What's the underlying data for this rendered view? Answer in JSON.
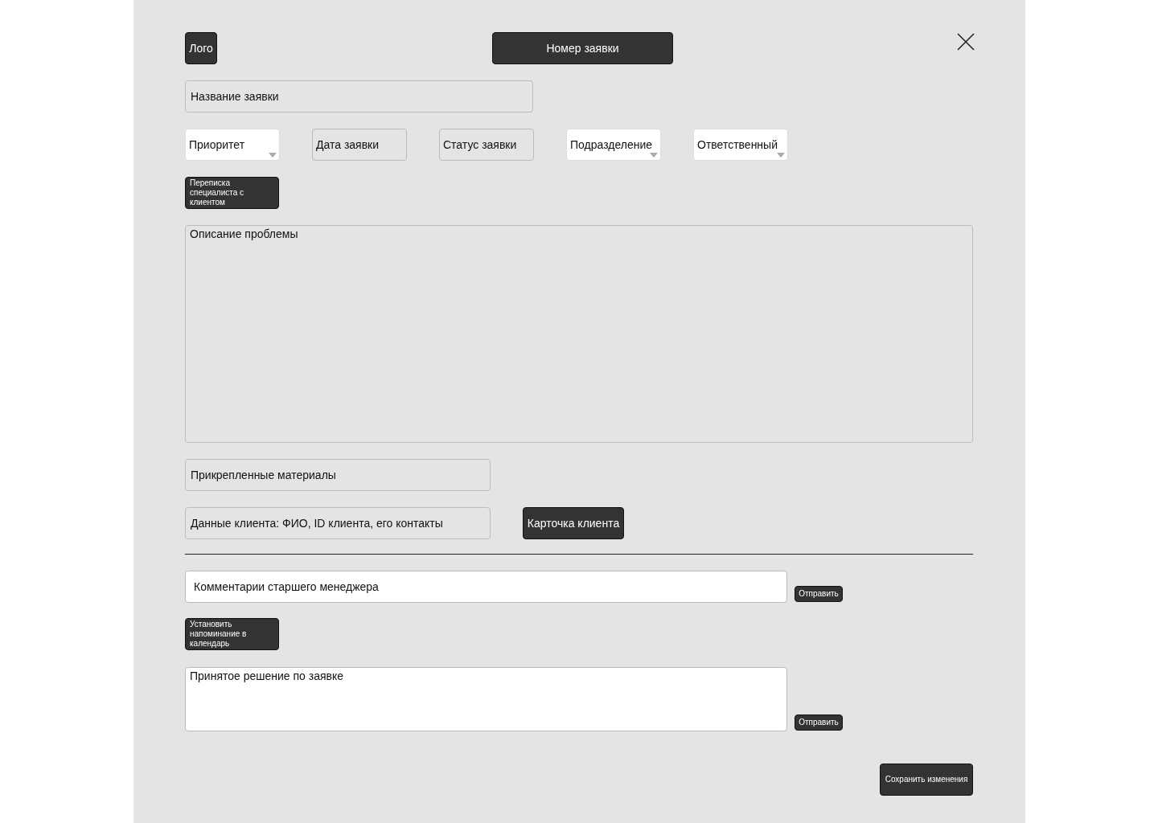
{
  "header": {
    "logo": "Лого",
    "request_number": "Номер заявки"
  },
  "title_field": {
    "placeholder": "Название заявки"
  },
  "filters": [
    {
      "kind": "dropdown",
      "placeholder": "Приоритет"
    },
    {
      "kind": "field",
      "placeholder": "Дата заявки"
    },
    {
      "kind": "field",
      "placeholder": "Статус заявки"
    },
    {
      "kind": "dropdown",
      "placeholder": "Подразделение"
    },
    {
      "kind": "dropdown",
      "placeholder": "Ответственный"
    }
  ],
  "chat_button": "Переписка специалиста с клиентом",
  "description": {
    "placeholder": "Описание проблемы"
  },
  "attachments": {
    "placeholder": "Прикрепленные материалы"
  },
  "client_data": {
    "placeholder": "Данные клиента: ФИО, ID клиента, его контакты"
  },
  "client_card_button": "Карточка клиента",
  "manager_comment": {
    "placeholder": "Комментарии старшего менеджера",
    "send": "Отправить"
  },
  "reminder_button": "Установить напоминание в календарь",
  "decision": {
    "placeholder": "Принятое решение по заявке",
    "send": "Отправить"
  },
  "save_button": "Сохранить изменения"
}
